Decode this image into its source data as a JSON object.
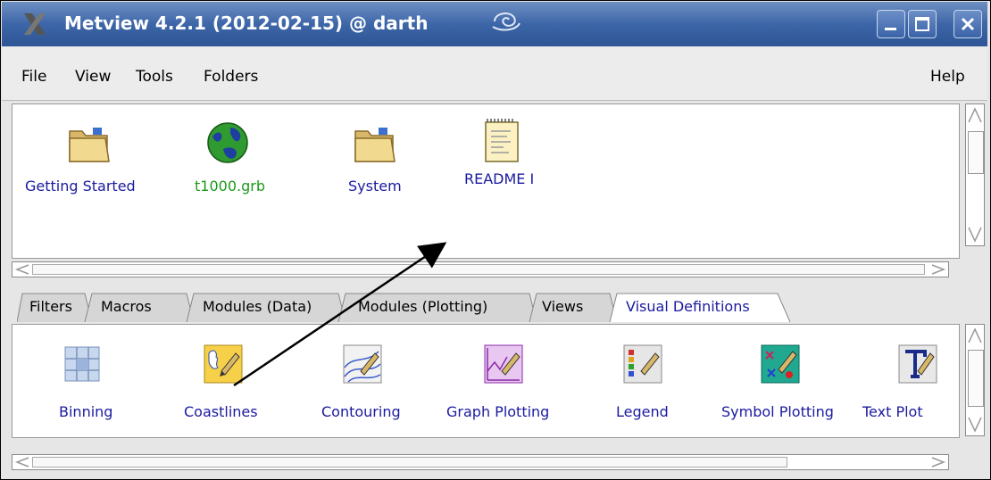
{
  "window": {
    "title": "Metview 4.2.1 (2012-02-15) @ darth",
    "buttons": [
      "minimize",
      "maximize",
      "close"
    ]
  },
  "menu": {
    "file": "File",
    "view": "View",
    "tools": "Tools",
    "folders": "Folders",
    "help": "Help"
  },
  "top_icons": [
    {
      "label": "Getting Started",
      "icon": "folder-icon"
    },
    {
      "label": "t1000.grb",
      "icon": "globe-icon"
    },
    {
      "label": "System",
      "icon": "folder-icon"
    },
    {
      "label": "README I",
      "icon": "notepad-icon"
    }
  ],
  "tabs": [
    {
      "label": "Filters"
    },
    {
      "label": "Macros"
    },
    {
      "label": "Modules (Data)"
    },
    {
      "label": "Modules (Plotting)"
    },
    {
      "label": "Views"
    },
    {
      "label": "Visual Definitions",
      "active": true
    }
  ],
  "bottom_icons": [
    {
      "label": "Binning",
      "icon": "grid-icon"
    },
    {
      "label": "Coastlines",
      "icon": "coastline-pen-icon"
    },
    {
      "label": "Contouring",
      "icon": "contour-pen-icon"
    },
    {
      "label": "Graph Plotting",
      "icon": "graph-pen-icon"
    },
    {
      "label": "Legend",
      "icon": "legend-pen-icon"
    },
    {
      "label": "Symbol Plotting",
      "icon": "symbol-pen-icon"
    },
    {
      "label": "Text Plot",
      "icon": "text-pen-icon"
    }
  ],
  "colors": {
    "title_bar": "#3d66a8",
    "icon_label": "#1a1aa0",
    "data_file_label": "#1a9a1a",
    "active_tab_label": "#1a1aa0"
  }
}
